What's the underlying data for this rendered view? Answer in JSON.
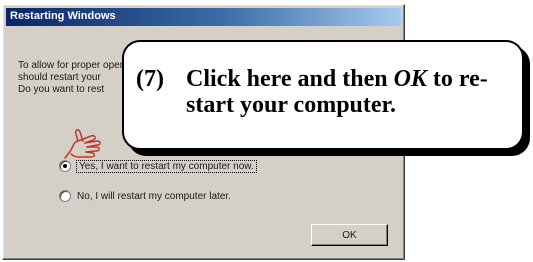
{
  "dialog": {
    "title": "Restarting Windows",
    "message_lines": [
      "To allow for proper operation of the YAMAHA SoftSynthesizer, you",
      "should restart your",
      "Do you want to rest"
    ],
    "options": [
      {
        "label": "Yes, I want to restart my computer now.",
        "selected": true
      },
      {
        "label": "No, I will restart my computer later.",
        "selected": false
      }
    ],
    "ok_label": "OK"
  },
  "callout": {
    "step": "(7)",
    "line1_pre": "Click here and then ",
    "line1_em": "OK",
    "line1_post": " to re-",
    "line2": "start your computer."
  },
  "icons": {
    "pointer": "pointing-hand-icon"
  },
  "colors": {
    "dialog_face": "#d4d0c8",
    "titlebar_start": "#0a246a",
    "titlebar_end": "#a6caf0",
    "hand_stroke": "#c0392b"
  }
}
